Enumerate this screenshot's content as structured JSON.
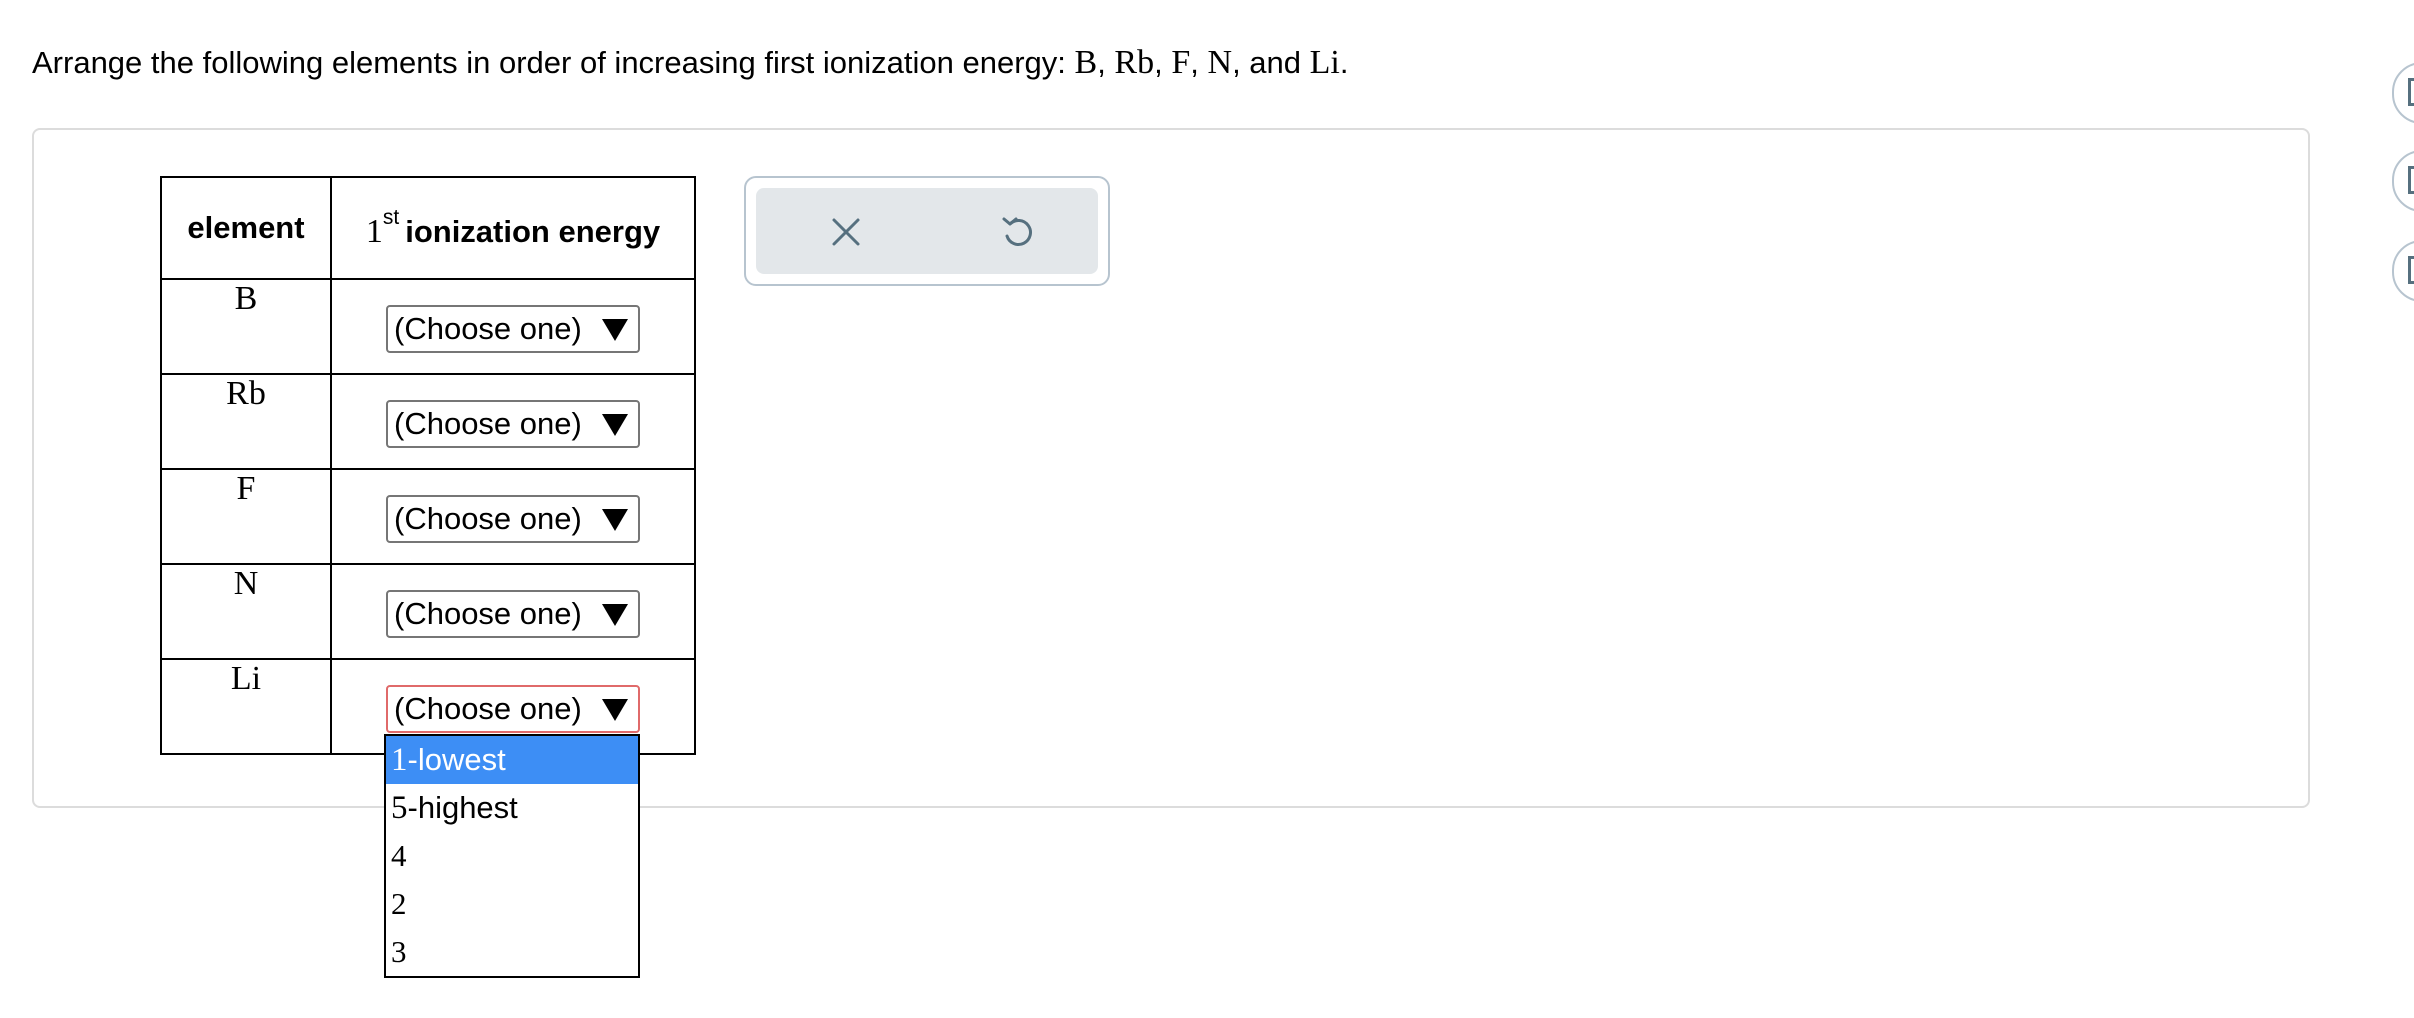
{
  "question": {
    "text_before": "Arrange the following elements in order of increasing first ionization energy: ",
    "elements_inline": [
      "B",
      "Rb",
      "F",
      "N",
      "Li"
    ],
    "separator": ", ",
    "and_word": "and",
    "end": "."
  },
  "table": {
    "header_element": "element",
    "header_ie_number": "1",
    "header_ie_sup": "st",
    "header_ie_text": "ionization energy",
    "rows": [
      {
        "element": "B",
        "select_value": "(Choose one)"
      },
      {
        "element": "Rb",
        "select_value": "(Choose one)"
      },
      {
        "element": "F",
        "select_value": "(Choose one)"
      },
      {
        "element": "N",
        "select_value": "(Choose one)"
      },
      {
        "element": "Li",
        "select_value": "(Choose one)"
      }
    ]
  },
  "dropdown": {
    "options": [
      {
        "num": "1",
        "suffix": "-lowest"
      },
      {
        "num": "5",
        "suffix": "-highest"
      },
      {
        "num": "4",
        "suffix": ""
      },
      {
        "num": "2",
        "suffix": ""
      },
      {
        "num": "3",
        "suffix": ""
      }
    ],
    "highlighted_index": 0
  },
  "tools": {
    "clear_icon": "close-icon",
    "undo_icon": "undo-icon"
  },
  "colors": {
    "highlight": "#3d8ef5",
    "active_border": "#e06a6a",
    "tool_bg": "#e3e7ea",
    "icon": "#56707f"
  }
}
